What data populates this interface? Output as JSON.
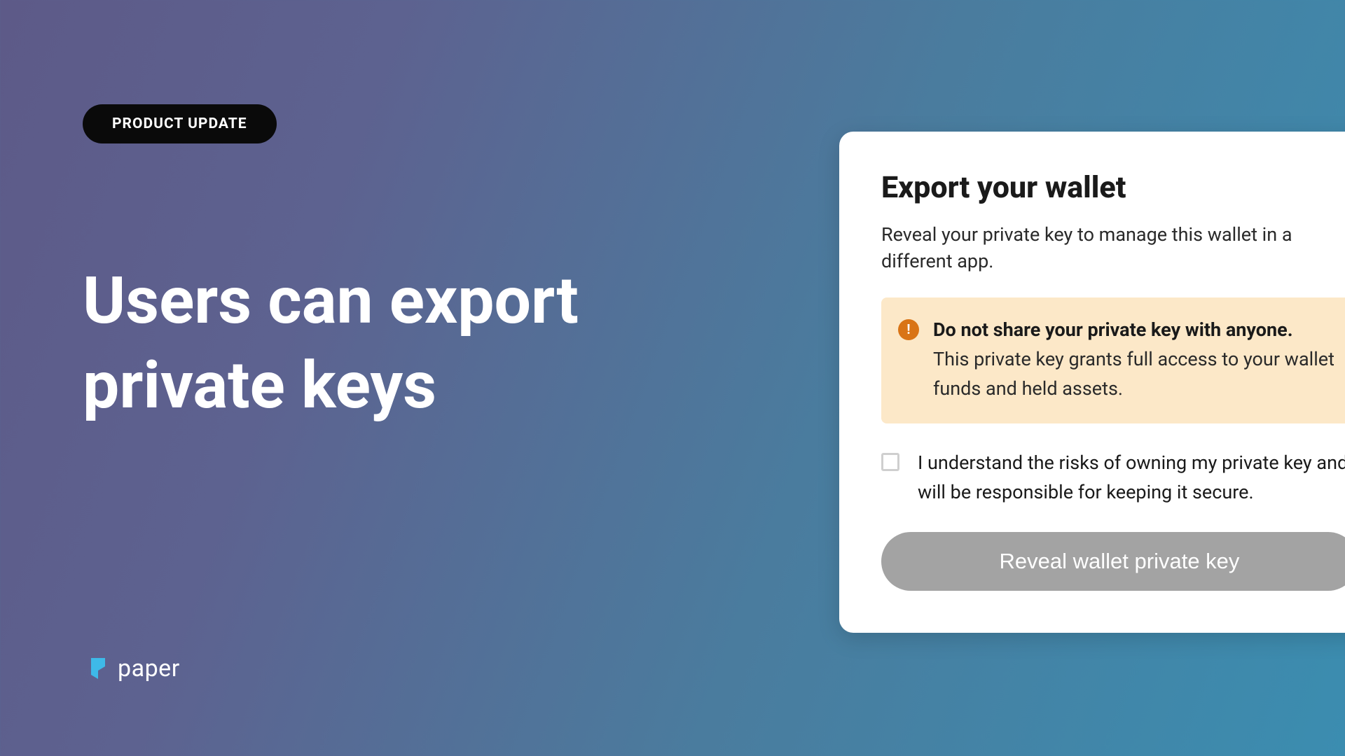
{
  "badge": {
    "label": "PRODUCT UPDATE"
  },
  "headline": "Users can export private keys",
  "brand": {
    "name": "paper"
  },
  "card": {
    "title": "Export your wallet",
    "subtitle": "Reveal your private key to manage this wallet in a different app.",
    "warning": {
      "title": "Do not share your private key with anyone.",
      "text": "This private key grants full access to your wallet funds and held assets."
    },
    "consent": {
      "text": "I understand the risks of owning my private key and will be responsible for keeping it secure."
    },
    "button": {
      "label": "Reveal wallet private key"
    }
  }
}
